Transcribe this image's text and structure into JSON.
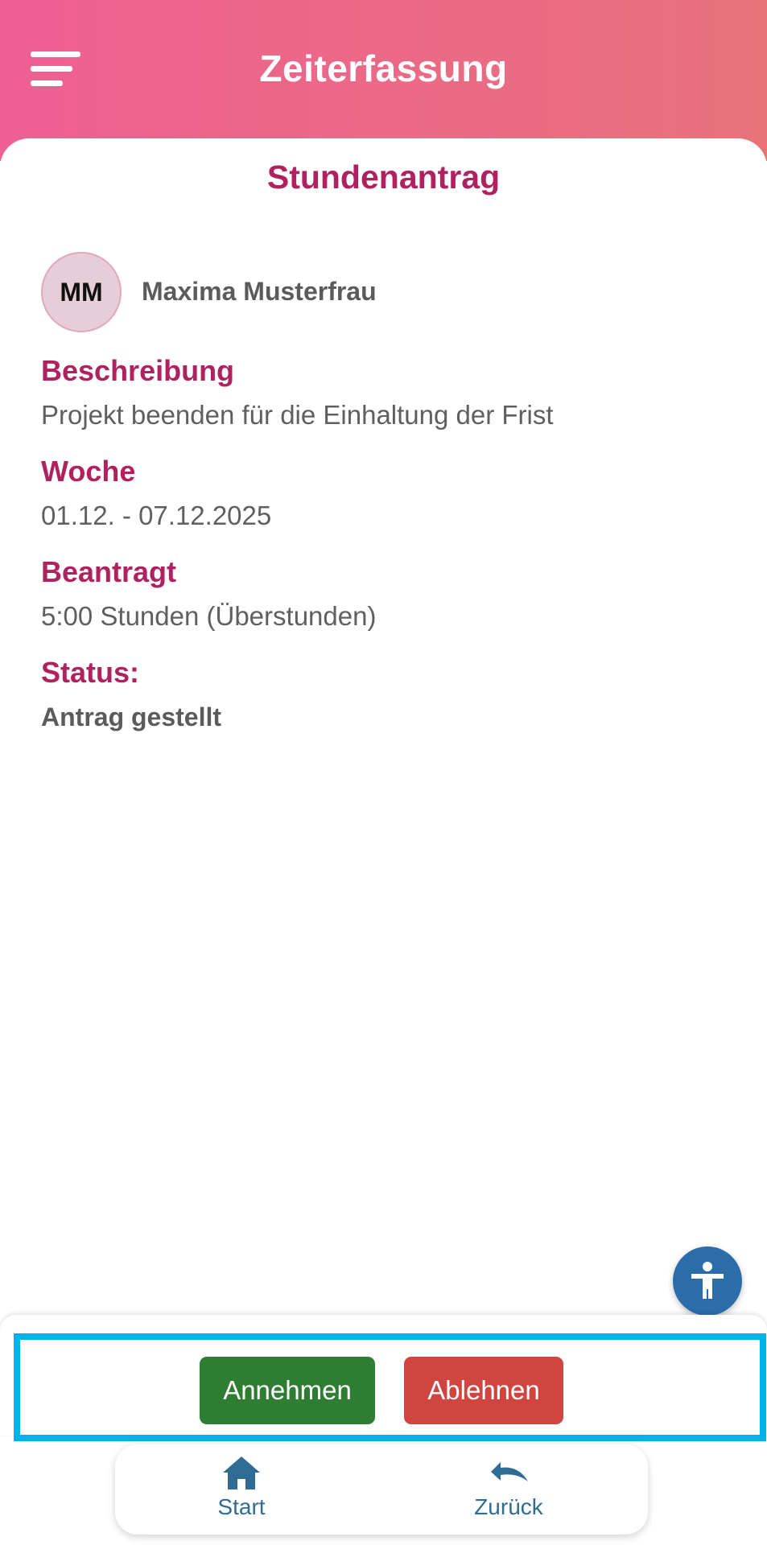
{
  "header": {
    "title": "Zeiterfassung",
    "menu_icon": "hamburger-menu-icon"
  },
  "card": {
    "title": "Stundenantrag",
    "user": {
      "initials": "MM",
      "name": "Maxima Musterfrau"
    },
    "fields": {
      "description_label": "Beschreibung",
      "description_value": "Projekt beenden für die Einhaltung der Frist",
      "week_label": "Woche",
      "week_value": "01.12. - 07.12.2025",
      "requested_label": "Beantragt",
      "requested_value": "5:00 Stunden (Überstunden)",
      "status_label": "Status:",
      "status_value": "Antrag gestellt"
    }
  },
  "actions": {
    "accept_label": "Annehmen",
    "reject_label": "Ablehnen"
  },
  "nav": {
    "start_label": "Start",
    "back_label": "Zurück"
  },
  "colors": {
    "header_gradient_start": "#ee5f93",
    "header_gradient_end": "#e8727a",
    "accent": "#b0215f",
    "accept": "#2e7d32",
    "reject": "#d14540",
    "nav_icon": "#2f6b93",
    "accessibility": "#2b6cab",
    "highlight": "#00b2ea"
  }
}
